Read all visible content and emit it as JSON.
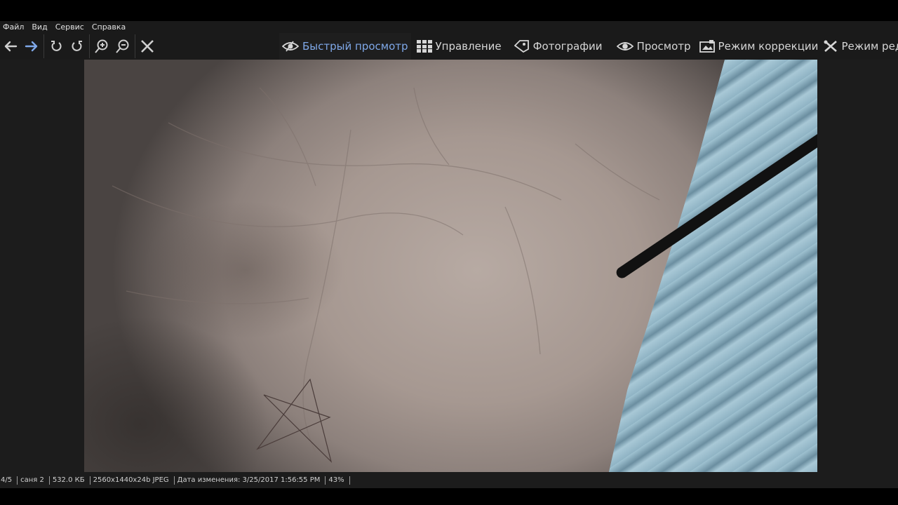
{
  "menu": {
    "items": [
      "Файл",
      "Вид",
      "Сервис",
      "Справка"
    ]
  },
  "toolbar": {
    "icons": [
      "arrow-left-icon",
      "arrow-right-icon",
      "rotate-left-icon",
      "rotate-right-icon",
      "zoom-in-icon",
      "zoom-out-icon",
      "close-icon"
    ],
    "accent": "#7fa8e8"
  },
  "modes": [
    {
      "label": "Быстрый просмотр",
      "icon": "quick-view-eye-icon",
      "active": true
    },
    {
      "label": "Управление",
      "icon": "grid-icon",
      "active": false
    },
    {
      "label": "Фотографии",
      "icon": "photos-tag-icon",
      "active": false
    },
    {
      "label": "Просмотр",
      "icon": "eye-icon",
      "active": false
    },
    {
      "label": "Режим коррекции",
      "icon": "correction-icon",
      "active": false
    },
    {
      "label": "Режим редактор",
      "icon": "editor-tools-icon",
      "active": false
    }
  ],
  "status": {
    "index": "4/5",
    "filename": "саня 2",
    "size": "532.0 КБ",
    "format": "2560x1440x24b JPEG",
    "modified": "Дата изменения: 3/25/2017 1:56:55 PM",
    "zoom": "43%"
  }
}
